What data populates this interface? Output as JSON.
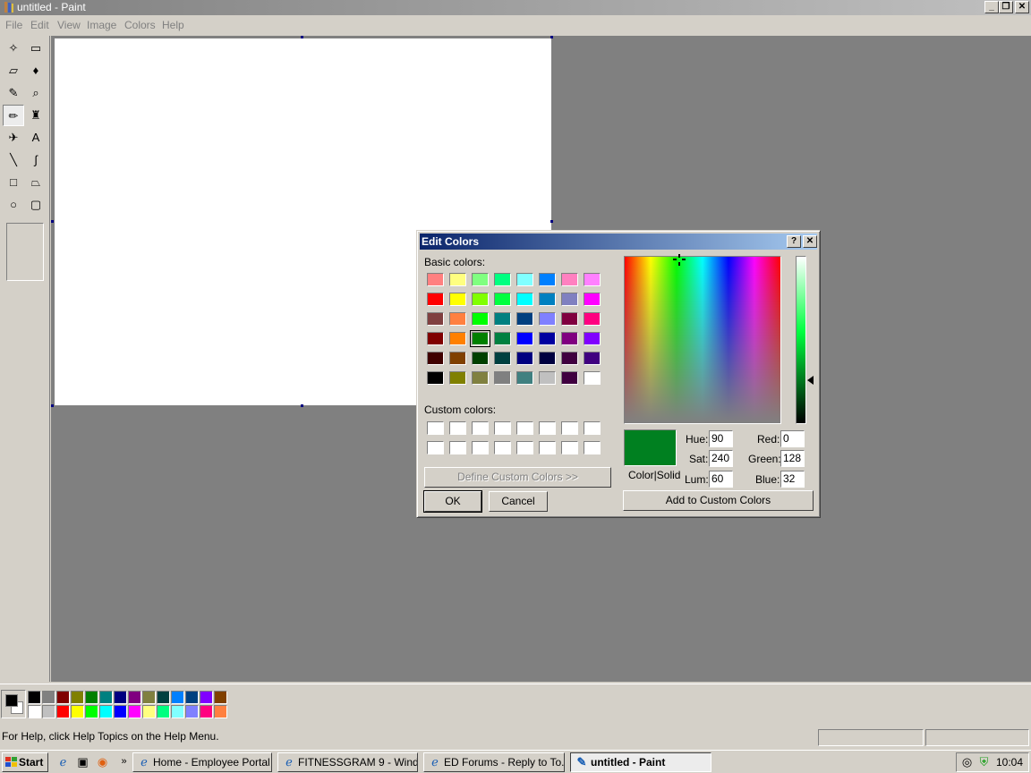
{
  "window": {
    "title": "untitled - Paint"
  },
  "menu": [
    "File",
    "Edit",
    "View",
    "Image",
    "Colors",
    "Help"
  ],
  "tools": [
    {
      "name": "free-select-icon",
      "glyph": "✧"
    },
    {
      "name": "select-icon",
      "glyph": "▭"
    },
    {
      "name": "eraser-icon",
      "glyph": "▱"
    },
    {
      "name": "fill-icon",
      "glyph": "♦"
    },
    {
      "name": "pick-color-icon",
      "glyph": "✎"
    },
    {
      "name": "magnifier-icon",
      "glyph": "⌕"
    },
    {
      "name": "pencil-icon",
      "glyph": "✏"
    },
    {
      "name": "brush-icon",
      "glyph": "♜"
    },
    {
      "name": "airbrush-icon",
      "glyph": "✈"
    },
    {
      "name": "text-icon",
      "glyph": "A"
    },
    {
      "name": "line-icon",
      "glyph": "╲"
    },
    {
      "name": "curve-icon",
      "glyph": "∫"
    },
    {
      "name": "rectangle-icon",
      "glyph": "□"
    },
    {
      "name": "polygon-icon",
      "glyph": "⏢"
    },
    {
      "name": "ellipse-icon",
      "glyph": "○"
    },
    {
      "name": "rounded-rect-icon",
      "glyph": "▢"
    }
  ],
  "palette": {
    "top": [
      "#000000",
      "#808080",
      "#800000",
      "#808000",
      "#008000",
      "#008080",
      "#000080",
      "#800080",
      "#808040",
      "#004040",
      "#0080ff",
      "#004080",
      "#8000ff",
      "#804000"
    ],
    "bottom": [
      "#ffffff",
      "#c0c0c0",
      "#ff0000",
      "#ffff00",
      "#00ff00",
      "#00ffff",
      "#0000ff",
      "#ff00ff",
      "#ffff80",
      "#00ff80",
      "#80ffff",
      "#8080ff",
      "#ff0080",
      "#ff8040"
    ]
  },
  "status": {
    "message": "For Help, click Help Topics on the Help Menu."
  },
  "taskbar": {
    "start": "Start",
    "tasks": [
      {
        "label": "Home - Employee Portal ...",
        "active": false
      },
      {
        "label": "FITNESSGRAM 9 - Windo...",
        "active": false
      },
      {
        "label": "ED Forums - Reply to To...",
        "active": false
      },
      {
        "label": "untitled - Paint",
        "active": true
      }
    ],
    "clock": "10:04"
  },
  "dialog": {
    "title": "Edit Colors",
    "basic_label": "Basic colors:",
    "custom_label": "Custom colors:",
    "basic_colors": [
      [
        "#ff8080",
        "#ffff80",
        "#80ff80",
        "#00ff80",
        "#80ffff",
        "#0080ff",
        "#ff80c0",
        "#ff80ff"
      ],
      [
        "#ff0000",
        "#ffff00",
        "#80ff00",
        "#00ff40",
        "#00ffff",
        "#0080c0",
        "#8080c0",
        "#ff00ff"
      ],
      [
        "#804040",
        "#ff8040",
        "#00ff00",
        "#008080",
        "#004080",
        "#8080ff",
        "#800040",
        "#ff0080"
      ],
      [
        "#800000",
        "#ff8000",
        "#008000",
        "#008040",
        "#0000ff",
        "#0000a0",
        "#800080",
        "#8000ff"
      ],
      [
        "#400000",
        "#804000",
        "#004000",
        "#004040",
        "#000080",
        "#000040",
        "#400040",
        "#400080"
      ],
      [
        "#000000",
        "#808000",
        "#808040",
        "#808080",
        "#408080",
        "#c0c0c0",
        "#400040",
        "#ffffff"
      ]
    ],
    "selected": [
      3,
      2
    ],
    "define_button": "Define Custom Colors >>",
    "ok": "OK",
    "cancel": "Cancel",
    "color_solid": "Color|Solid",
    "add_button": "Add to Custom Colors",
    "current_color": "#008020",
    "fields": {
      "hue_label": "Hue:",
      "hue": "90",
      "sat_label": "Sat:",
      "sat": "240",
      "lum_label": "Lum:",
      "lum": "60",
      "red_label": "Red:",
      "red": "0",
      "green_label": "Green:",
      "green": "128",
      "blue_label": "Blue:",
      "blue": "32"
    }
  }
}
